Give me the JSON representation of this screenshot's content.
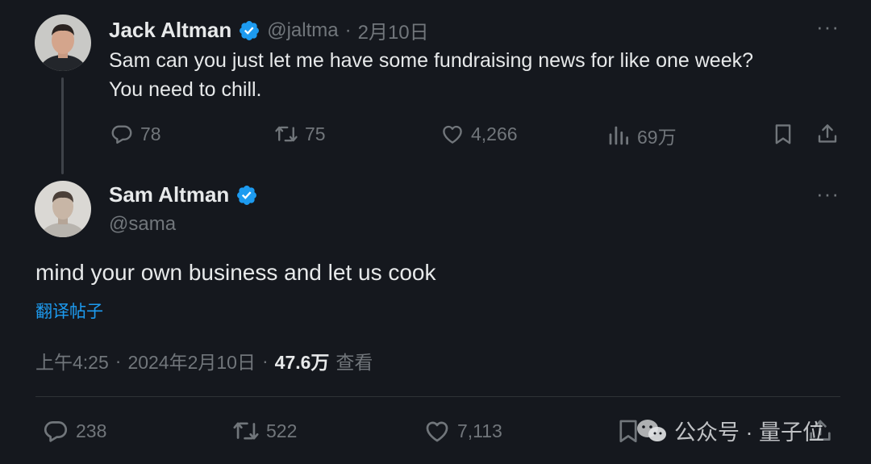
{
  "parent_tweet": {
    "display_name": "Jack Altman",
    "handle": "@jaltma",
    "separator": "·",
    "date": "2月10日",
    "text_line1": "Sam can you just let me have some fundraising news for like one week?",
    "text_line2": "You need to chill.",
    "replies": "78",
    "retweets": "75",
    "likes": "4,266",
    "views": "69万",
    "more": "···"
  },
  "main_tweet": {
    "display_name": "Sam Altman",
    "handle": "@sama",
    "text": "mind your own business and let us cook",
    "translate_label": "翻译帖子",
    "time": "上午4:25",
    "date": "2024年2月10日",
    "separator": "·",
    "views_count": "47.6万",
    "views_label": "查看",
    "replies": "238",
    "retweets": "522",
    "likes": "7,113",
    "more": "···"
  },
  "watermark": {
    "text": "公众号 · 量子位"
  },
  "colors": {
    "background": "#15181e",
    "verified_badge": "#1d9bf0",
    "link": "#1d9bf0",
    "secondary_text": "#71767b"
  }
}
